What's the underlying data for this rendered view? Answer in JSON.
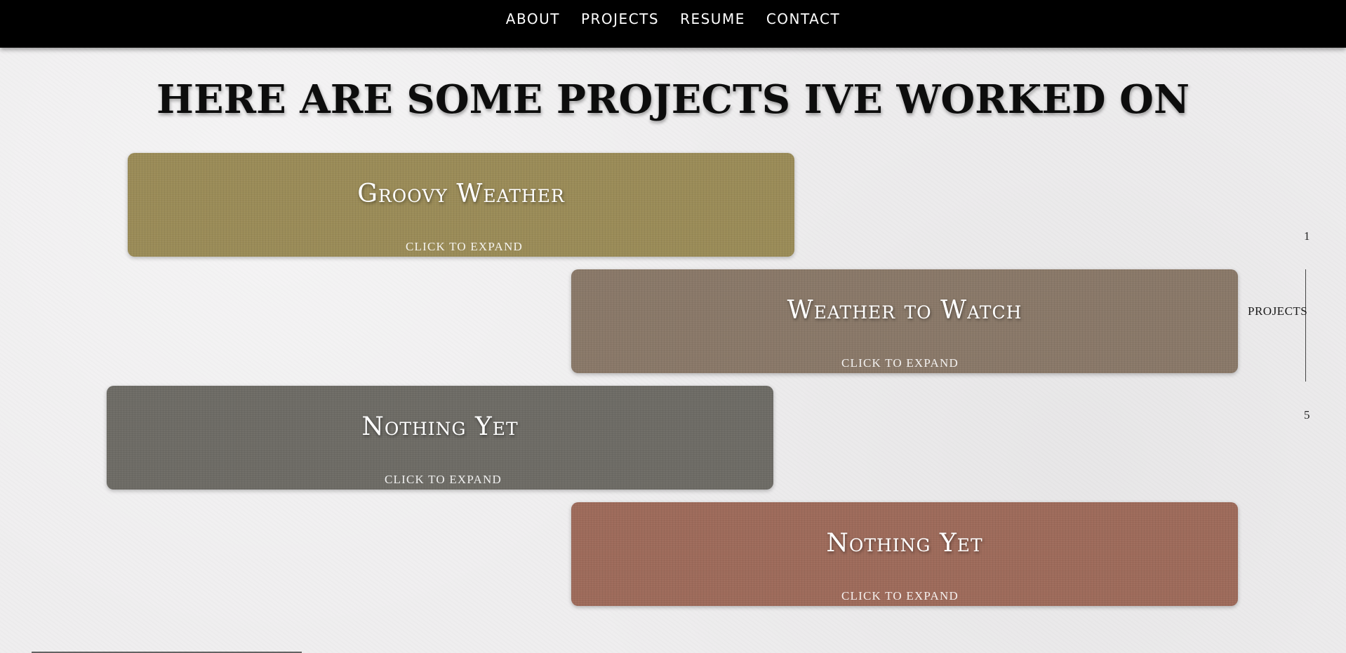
{
  "nav": {
    "items": [
      "ABOUT",
      "PROJECTS",
      "RESUME",
      "CONTACT"
    ]
  },
  "page": {
    "title": "HERE ARE SOME PROJECTS IVE WORKED ON"
  },
  "projects": [
    {
      "title": "Groovy Weather",
      "expand_label": "CLICK TO EXPAND",
      "color": "#9a8b57"
    },
    {
      "title": "Weather to Watch",
      "expand_label": "CLICK TO EXPAND",
      "color": "#897868"
    },
    {
      "title": "Nothing Yet",
      "expand_label": "CLICK TO EXPAND",
      "color": "#6d6b65"
    },
    {
      "title": "Nothing Yet",
      "expand_label": "CLICK TO EXPAND",
      "color": "#9d6a5a"
    }
  ],
  "side_indicator": {
    "start": "1",
    "label": "PROJECTS",
    "end": "5"
  },
  "colors": {
    "navbar": "#000000",
    "background": "#efeeef",
    "title_text": "#0d0d0d"
  }
}
